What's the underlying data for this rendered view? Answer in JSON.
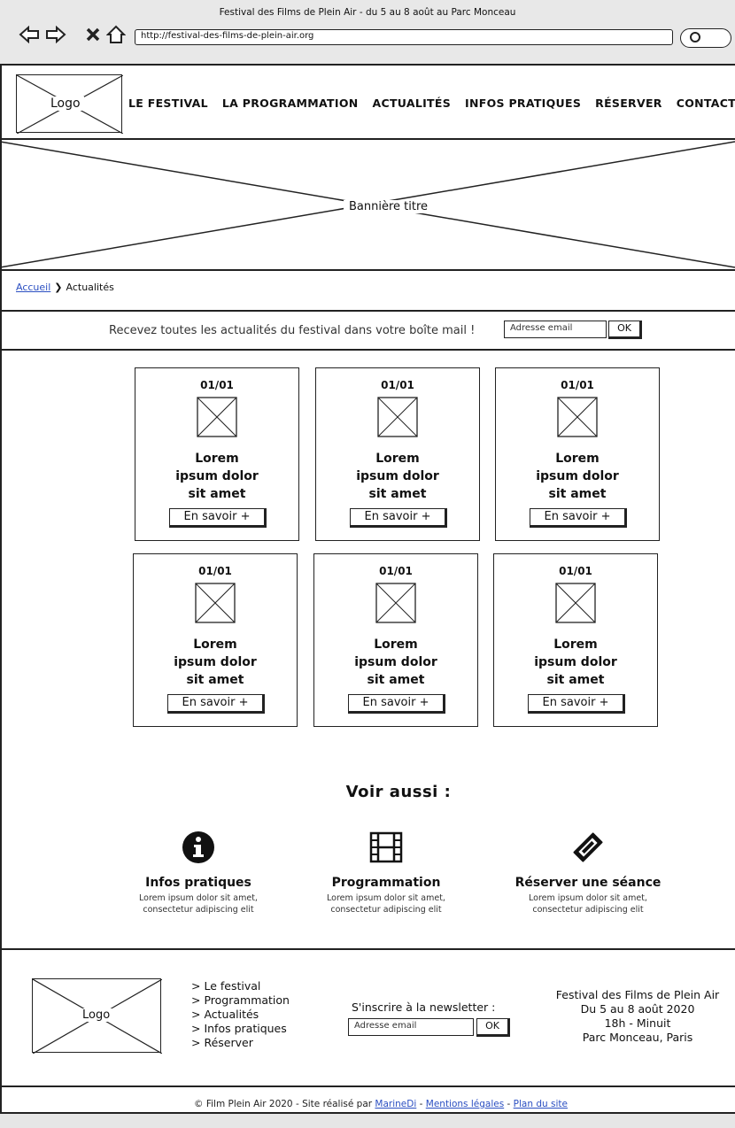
{
  "browser": {
    "window_title": "Festival des Films de Plein Air - du 5 au 8 août au Parc Monceau",
    "url": "http://festival-des-films-de-plein-air.org"
  },
  "header": {
    "logo_label": "Logo",
    "nav": [
      "LE FESTIVAL",
      "LA PROGRAMMATION",
      "ACTUALITÉS",
      "INFOS PRATIQUES",
      "RÉSERVER",
      "CONTACT"
    ]
  },
  "banner": {
    "label": "Bannière titre"
  },
  "breadcrumb": {
    "home": "Accueil",
    "separator": "❯",
    "current": "Actualités"
  },
  "newsletter": {
    "text": "Recevez toutes les actualités du festival dans votre boîte mail !",
    "placeholder": "Adresse email",
    "button": "OK"
  },
  "articles": [
    {
      "date": "01/01",
      "title_lines": [
        "Lorem",
        "ipsum dolor",
        "sit amet"
      ],
      "button": "En savoir +"
    },
    {
      "date": "01/01",
      "title_lines": [
        "Lorem",
        "ipsum dolor",
        "sit amet"
      ],
      "button": "En savoir +"
    },
    {
      "date": "01/01",
      "title_lines": [
        "Lorem",
        "ipsum dolor",
        "sit amet"
      ],
      "button": "En savoir +"
    },
    {
      "date": "01/01",
      "title_lines": [
        "Lorem",
        "ipsum dolor",
        "sit amet"
      ],
      "button": "En savoir +"
    },
    {
      "date": "01/01",
      "title_lines": [
        "Lorem",
        "ipsum dolor",
        "sit amet"
      ],
      "button": "En savoir +"
    },
    {
      "date": "01/01",
      "title_lines": [
        "Lorem",
        "ipsum dolor",
        "sit amet"
      ],
      "button": "En savoir +"
    }
  ],
  "see_also": {
    "title": "Voir aussi :",
    "items": [
      {
        "icon": "info-icon",
        "name": "Infos pratiques",
        "desc_lines": [
          "Lorem ipsum dolor sit amet,",
          "consectetur adipiscing elit"
        ]
      },
      {
        "icon": "film-icon",
        "name": "Programmation",
        "desc_lines": [
          "Lorem ipsum dolor sit amet,",
          "consectetur adipiscing elit"
        ]
      },
      {
        "icon": "ticket-icon",
        "name": "Réserver une séance",
        "desc_lines": [
          "Lorem ipsum dolor sit amet,",
          "consectetur adipiscing elit"
        ]
      }
    ]
  },
  "footer": {
    "logo_label": "Logo",
    "links": [
      "> Le festival",
      "> Programmation",
      "> Actualités",
      "> Infos pratiques",
      "> Réserver"
    ],
    "newsletter_label": "S'inscrire à la newsletter :",
    "newsletter_placeholder": "Adresse email",
    "newsletter_button": "OK",
    "info_lines": [
      "Festival des Films de Plein Air",
      "Du 5 au 8 août 2020",
      "18h - Minuit",
      "Parc Monceau, Paris"
    ]
  },
  "copyright": {
    "prefix": "© Film Plein Air 2020 - Site réalisé par",
    "author": "MarineDi",
    "dash1": "-",
    "legal": "Mentions légales",
    "dash2": "-",
    "sitemap": "Plan du site"
  }
}
